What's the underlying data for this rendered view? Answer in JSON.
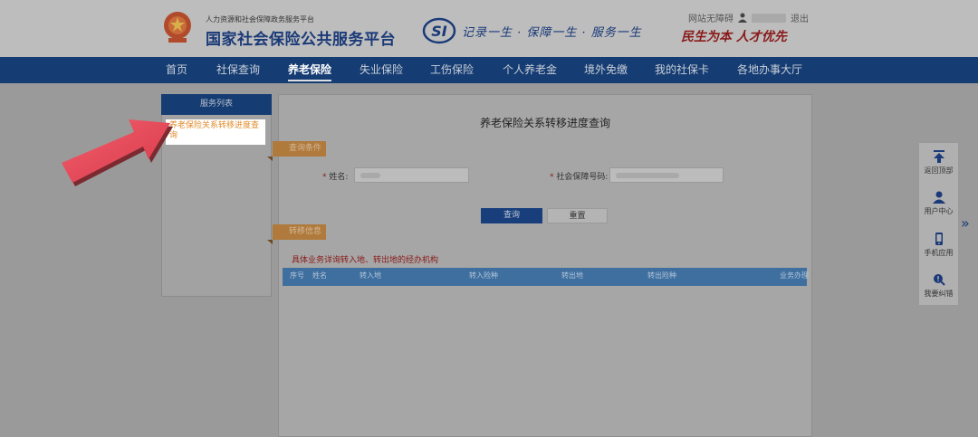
{
  "header": {
    "org_small": "人力资源和社会保障政务服务平台",
    "org_title": "国家社会保险公共服务平台",
    "si_logo_text": "SI",
    "slogan": "记录一生 · 保障一生 · 服务一生",
    "welcome": "网站无障碍",
    "logout": "退出",
    "motto": "民生为本 人才优先"
  },
  "nav": {
    "items": [
      "首页",
      "社保查询",
      "养老保险",
      "失业保险",
      "工伤保险",
      "个人养老金",
      "境外免缴",
      "我的社保卡",
      "各地办事大厅"
    ],
    "active": "养老保险"
  },
  "sidebar": {
    "title": "服务列表",
    "link": "养老保险关系转移进度查询"
  },
  "main": {
    "title": "养老保险关系转移进度查询",
    "query_section": "查询条件",
    "name_label": "姓名:",
    "ssn_label": "社会保障号码:",
    "query_button": "查询",
    "reset_button": "重置",
    "result_section": "转移信息",
    "note": "具体业务详询转入地、转出地的经办机构",
    "columns": [
      "序号",
      "姓名",
      "转入地",
      "转入险种",
      "转出地",
      "转出险种",
      "业务办理"
    ]
  },
  "rail": {
    "items": [
      {
        "label": "返回顶部",
        "icon": "arrow-up-icon"
      },
      {
        "label": "用户中心",
        "icon": "user-icon"
      },
      {
        "label": "手机应用",
        "icon": "phone-icon"
      },
      {
        "label": "我要纠错",
        "icon": "search-icon"
      }
    ]
  },
  "colors": {
    "nav_bg": "#153c73",
    "accent_orange": "#b07a3c",
    "highlight_link": "#e08a2a",
    "arrow_red": "#e8475a"
  }
}
